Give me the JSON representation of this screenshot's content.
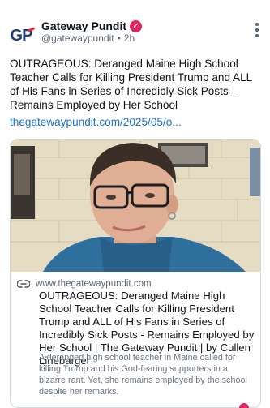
{
  "post": {
    "author_name": "Gateway Pundit",
    "avatar_text": "GP",
    "handle": "@gatewaypundit",
    "separator": "•",
    "time": "2h",
    "text": "OUTRAGEOUS: Deranged Maine High School Teacher Calls for Killing President Trump and ALL of His Fans in Series of Incredibly Sick Posts – Remains Employed by Her School",
    "link": "thegatewaypundit.com/2025/05/o..."
  },
  "card": {
    "domain": "www.thegatewaypundit.com",
    "title": "OUTRAGEOUS: Deranged Maine High School Teacher Calls for Killing President Trump and ALL of His Fans in Series of Incredibly Sick Posts - Remains Employed by Her School | The Gateway Pundit | by Cullen Linebarger",
    "description": "A deranged high school teacher in Maine called for killing Trump and his God-fearing supporters in a bizarre rant. Yet, she remains employed by the school despite her remarks."
  },
  "colors": {
    "verified_badge": "#e0245e",
    "link": "#1d72d1",
    "avatar_blue": "#1f3b7a",
    "avatar_red": "#e2312d"
  },
  "icons": [
    "verified-icon",
    "more-options-icon",
    "link-icon"
  ]
}
